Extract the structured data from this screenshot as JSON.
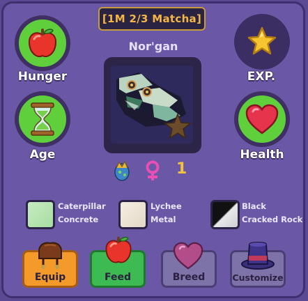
{
  "badge": "[1M 2/3 Matcha]",
  "pet_name": "Nor'gan",
  "stats": {
    "hunger": "Hunger",
    "exp": "EXP.",
    "age": "Age",
    "health": "Health"
  },
  "pet_info": {
    "level": "1"
  },
  "traits": [
    {
      "line1": "Caterpillar",
      "line2": "Concrete"
    },
    {
      "line1": "Lychee",
      "line2": "Metal"
    },
    {
      "line1": "Black",
      "line2": "Cracked Rock"
    }
  ],
  "actions": {
    "equip": "Equip",
    "feed": "Feed",
    "breed": "Breed",
    "customize": "Customize"
  },
  "colors": {
    "panel": "#6a58a6",
    "badge_text": "#f3b646",
    "hunger_ring": "#5fcf3c",
    "equip": "#f39a2a",
    "feed": "#3dbb52",
    "breed": "#7e73a8",
    "customize": "#7e73a8"
  },
  "icons": {
    "hunger": "apple-icon",
    "exp": "star-icon",
    "age": "hourglass-icon",
    "health": "heart-icon",
    "species": "dragon-egg-icon",
    "gender": "female-icon",
    "equip": "saddle-icon",
    "feed": "apple-icon",
    "breed": "heart-icon",
    "customize": "top-hat-icon"
  }
}
